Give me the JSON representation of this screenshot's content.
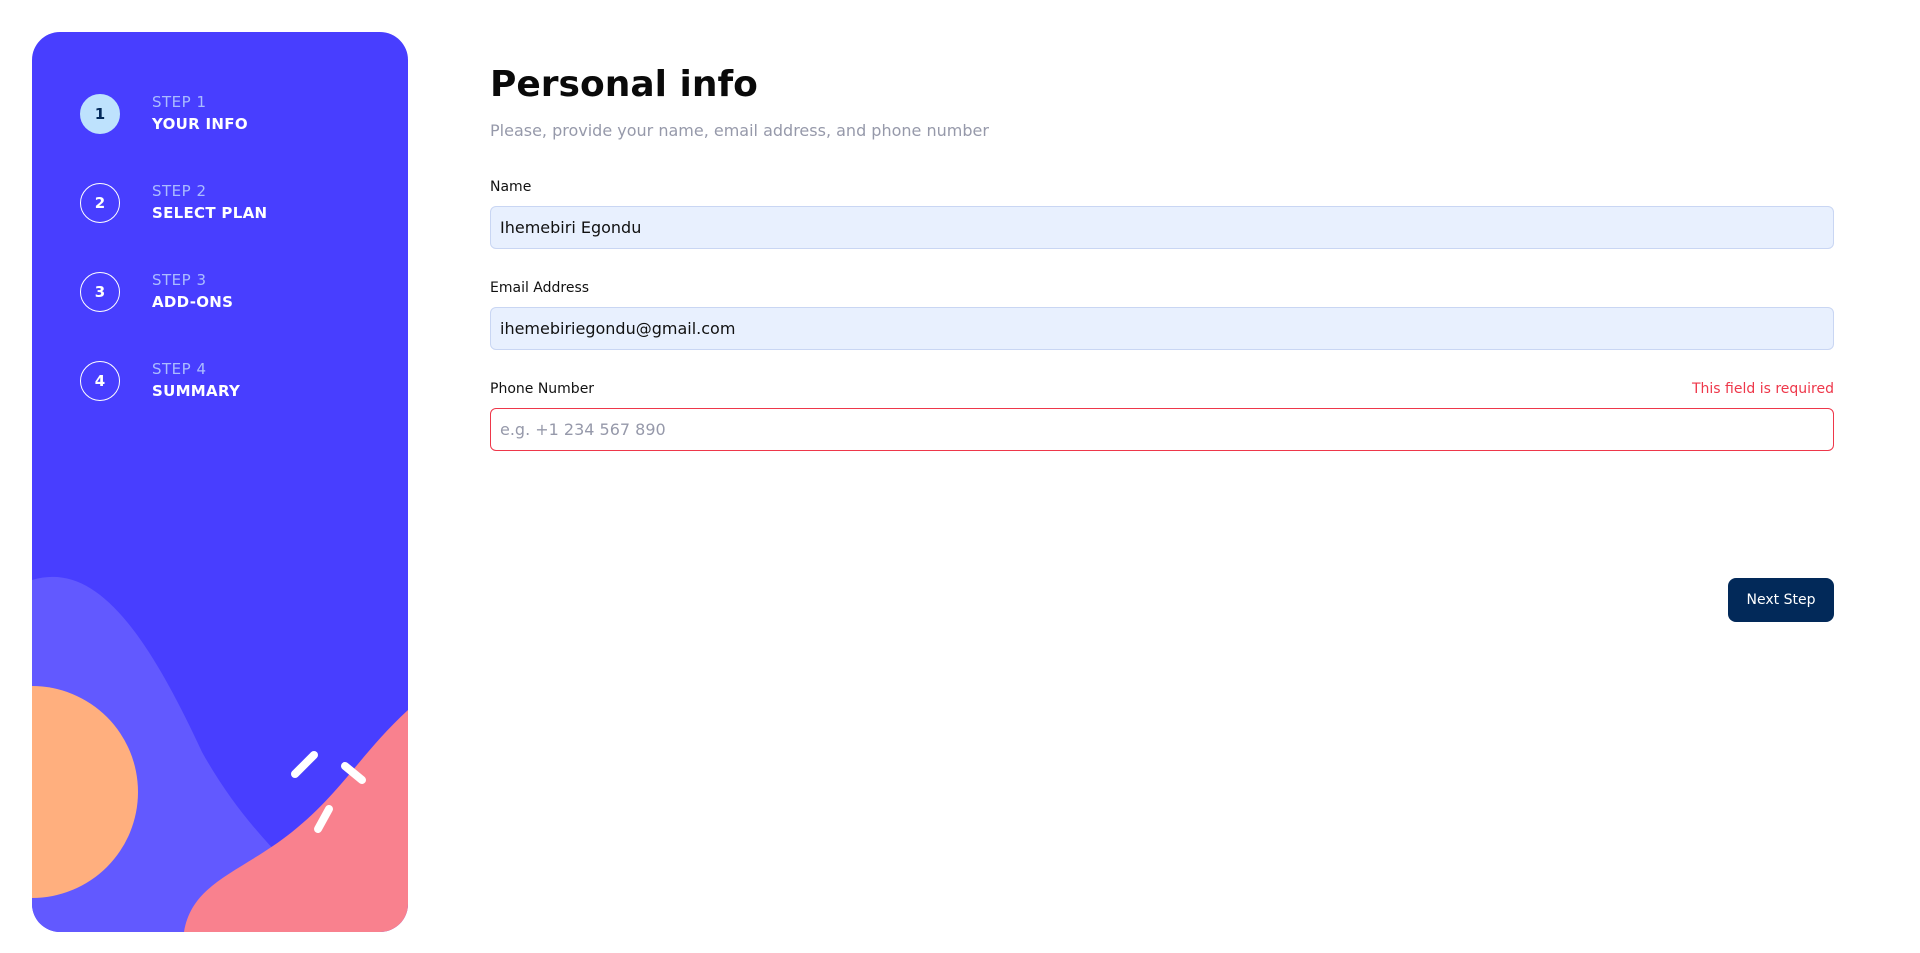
{
  "sidebar": {
    "steps": [
      {
        "number": "1",
        "label": "STEP 1",
        "title": "YOUR INFO",
        "active": true
      },
      {
        "number": "2",
        "label": "STEP 2",
        "title": "SELECT PLAN",
        "active": false
      },
      {
        "number": "3",
        "label": "STEP 3",
        "title": "ADD-ONS",
        "active": false
      },
      {
        "number": "4",
        "label": "STEP 4",
        "title": "SUMMARY",
        "active": false
      }
    ],
    "decoration": "abstract-shapes-illustration"
  },
  "form": {
    "title": "Personal info",
    "subtitle": "Please, provide your name, email address, and phone number",
    "fields": {
      "name": {
        "label": "Name",
        "value": "Ihemebiri Egondu"
      },
      "email": {
        "label": "Email Address",
        "value": "ihemebiriegondu@gmail.com"
      },
      "phone": {
        "label": "Phone Number",
        "value": "",
        "placeholder": "e.g. +1 234 567 890",
        "error": "This field is required"
      }
    },
    "next_label": "Next Step"
  },
  "colors": {
    "sidebar_bg": "#483eff",
    "active_step": "#bee2fd",
    "button": "#022959",
    "error": "#ee374a",
    "filled_input": "#e8f0fe"
  }
}
